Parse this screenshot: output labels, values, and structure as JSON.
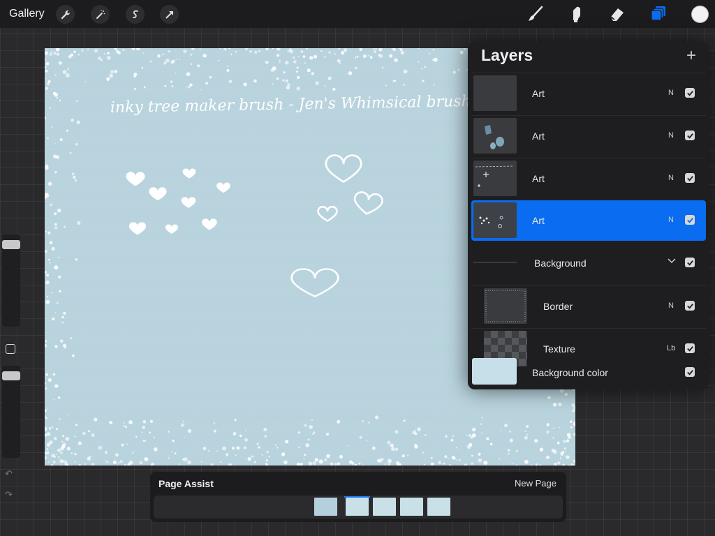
{
  "topbar": {
    "gallery_label": "Gallery",
    "left_tools": [
      "wrench-icon",
      "magic-wand-icon",
      "selection-icon",
      "transform-arrow-icon"
    ],
    "right_tools": [
      "brush-icon",
      "smudge-icon",
      "eraser-icon",
      "layers-icon"
    ],
    "active_tool": "layers-icon",
    "current_color": "#f2f2f2",
    "accent_color": "#0a6cf0"
  },
  "canvas": {
    "background_color": "#b8d3dd",
    "handwritten_text": "inky tree maker brush - Jen's Whimsical brush"
  },
  "layers": {
    "title": "Layers",
    "add_label": "+",
    "items": [
      {
        "name": "Art",
        "blend": "N",
        "visible": true,
        "selected": false
      },
      {
        "name": "Art",
        "blend": "N",
        "visible": true,
        "selected": false
      },
      {
        "name": "Art",
        "blend": "N",
        "visible": true,
        "selected": false
      },
      {
        "name": "Art",
        "blend": "N",
        "visible": true,
        "selected": true
      },
      {
        "name": "Background",
        "blend": "",
        "visible": true,
        "group": true
      },
      {
        "name": "Border",
        "blend": "N",
        "visible": true,
        "selected": false
      },
      {
        "name": "Texture",
        "blend": "Lb",
        "visible": true,
        "selected": false
      },
      {
        "name": "Background color",
        "blend": "",
        "visible": true,
        "selected": false
      }
    ]
  },
  "page_assist": {
    "title": "Page Assist",
    "new_page_label": "New Page",
    "page_count": 5,
    "current_page": 2
  }
}
